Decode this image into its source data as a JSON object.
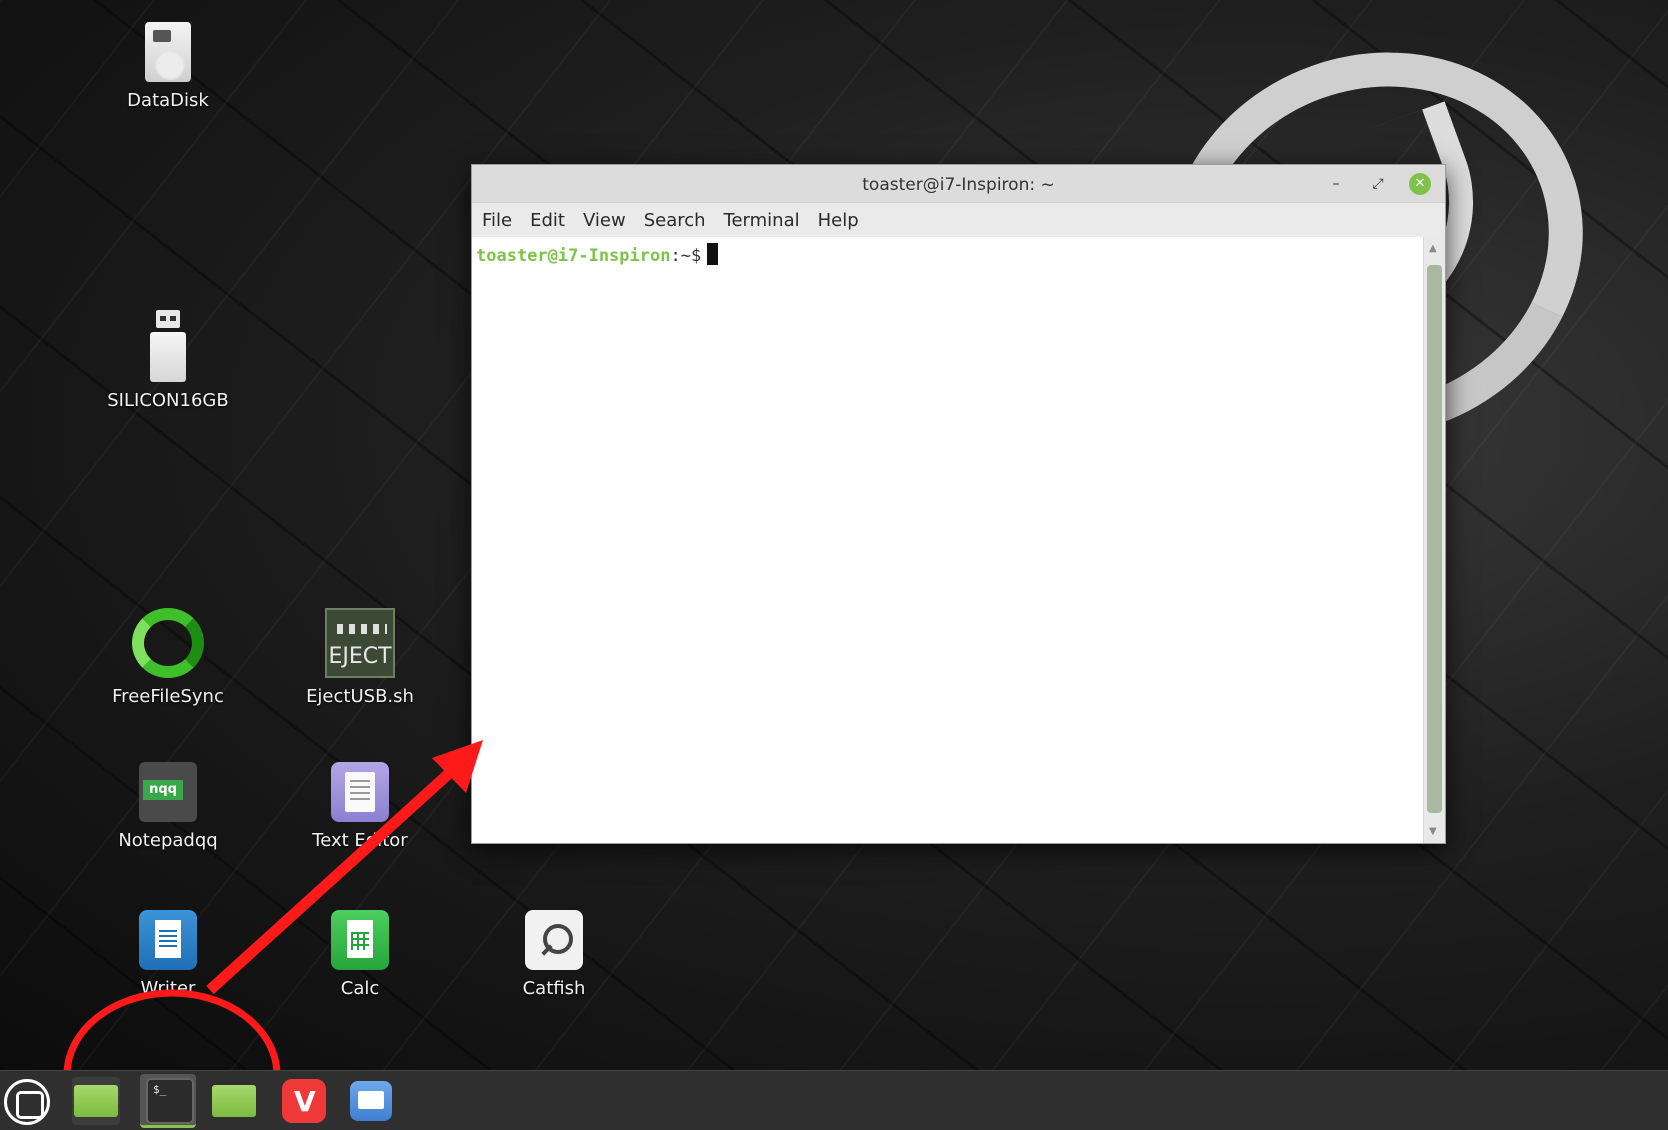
{
  "desktop": {
    "icons": [
      {
        "label": "DataDisk"
      },
      {
        "label": "SILICON16GB"
      },
      {
        "label": "FreeFileSync"
      },
      {
        "label": "EjectUSB.sh",
        "image_text": "EJECT"
      },
      {
        "label": "Notepadqq"
      },
      {
        "label": "Text Editor"
      },
      {
        "label": "Writer"
      },
      {
        "label": "Calc"
      },
      {
        "label": "Catfish"
      }
    ]
  },
  "terminal": {
    "title": "toaster@i7-Inspiron: ~",
    "menu": [
      "File",
      "Edit",
      "View",
      "Search",
      "Terminal",
      "Help"
    ],
    "prompt_user": "toaster@i7-Inspiron",
    "prompt_suffix": ":~$",
    "close_glyph": "✕",
    "minimize_glyph": "–",
    "maximize_glyph": "⤢"
  },
  "taskbar": {
    "items": [
      {
        "icon": "mint-menu-icon"
      },
      {
        "icon": "folder-icon"
      },
      {
        "icon": "terminal-icon",
        "active": true
      },
      {
        "icon": "folder-icon"
      },
      {
        "icon": "vivaldi-icon"
      },
      {
        "icon": "mail-icon"
      }
    ]
  },
  "colors": {
    "prompt_user": "#7ec24a",
    "annotation": "#ff1a1a",
    "taskbar": "#2f2f2f"
  }
}
